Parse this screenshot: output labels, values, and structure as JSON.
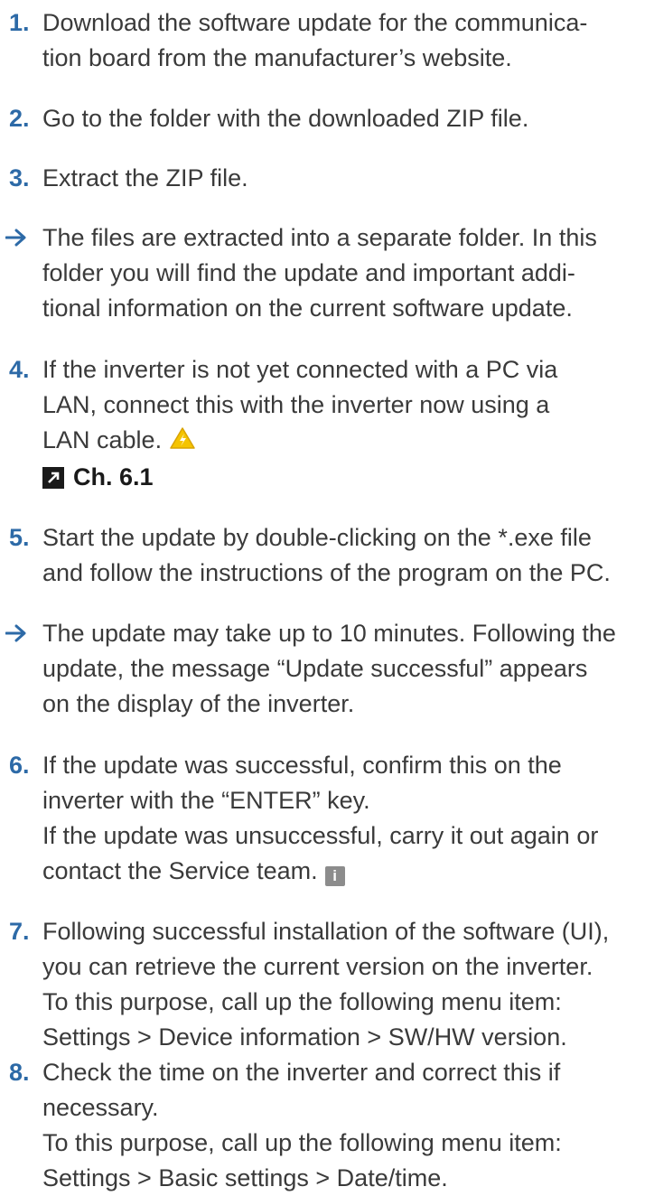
{
  "steps": [
    {
      "marker": "1.",
      "lines": [
        "Download the software update for the communica-",
        "tion board from the manufacturer’s website."
      ]
    },
    {
      "marker": "2.",
      "lines": [
        "Go to the folder with the downloaded ZIP file."
      ]
    },
    {
      "marker": "3.",
      "lines": [
        "Extract the ZIP file."
      ]
    },
    {
      "marker": "→",
      "lines": [
        "The files are extracted into a separate folder. In this",
        "folder you will find the update and important addi-",
        "tional information on the current software update."
      ]
    },
    {
      "marker": "4.",
      "lines": [
        "If the inverter is not yet connected with a PC via",
        "LAN, connect this with the inverter now using a",
        "LAN cable."
      ],
      "icon": "warning-triangle-icon",
      "ref": "Ch. 6.1"
    },
    {
      "marker": "5.",
      "lines": [
        "Start the update by double-clicking on the *.exe file",
        "and follow the instructions of the program on the PC."
      ]
    },
    {
      "marker": "→",
      "lines": [
        "The update may take up to 10 minutes. Following the",
        "update, the message “Update successful” appears",
        "on the display of the inverter."
      ]
    },
    {
      "marker": "6.",
      "lines": [
        "If the update was successful, confirm this on the",
        "inverter with the “ENTER” key.",
        "If the update was unsuccessful, carry it out again or",
        "contact the Service team."
      ],
      "icon": "info-icon"
    },
    {
      "marker": "7.",
      "lines": [
        "Following successful installation of the software (UI),",
        "you can retrieve the current version on the inverter.",
        "To this purpose, call up the following menu item:",
        "Settings > Device information > SW/HW version."
      ]
    },
    {
      "marker": "8.",
      "lines": [
        "Check the time on the inverter and correct this if",
        "necessary.",
        "To this purpose, call up the following menu item:",
        "Settings > Basic settings > Date/time."
      ]
    }
  ],
  "colors": {
    "accent": "#2d6aa7",
    "text": "#3a3a3a",
    "warning": "#f5c400",
    "info_bg": "#8c8c8c"
  }
}
